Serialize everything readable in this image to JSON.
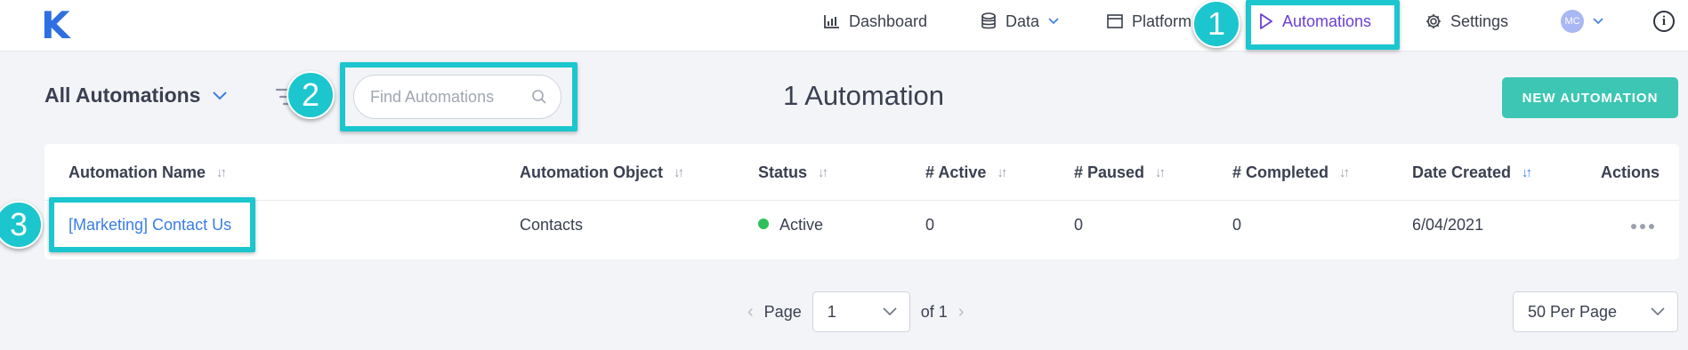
{
  "app": {
    "logo": "K"
  },
  "nav": {
    "items": [
      {
        "label": "Dashboard",
        "icon": "bar-chart-icon"
      },
      {
        "label": "Data",
        "icon": "database-icon"
      },
      {
        "label": "Platform",
        "icon": "window-icon"
      },
      {
        "label": "Automations",
        "icon": "play-icon",
        "active": true
      },
      {
        "label": "Settings",
        "icon": "gear-icon"
      }
    ],
    "avatar_initials": "MC",
    "info_glyph": "i"
  },
  "toolbar": {
    "view_label": "All Automations",
    "search_placeholder": "Find Automations",
    "count_title": "1 Automation",
    "new_button": "NEW AUTOMATION"
  },
  "table": {
    "columns": [
      "Automation Name",
      "Automation Object",
      "Status",
      "# Active",
      "# Paused",
      "# Completed",
      "Date Created",
      "Actions"
    ],
    "rows": [
      {
        "name": "[Marketing] Contact Us",
        "object": "Contacts",
        "status": "Active",
        "active": "0",
        "paused": "0",
        "completed": "0",
        "date_created": "6/04/2021"
      }
    ]
  },
  "pagination": {
    "page_label": "Page",
    "page_value": "1",
    "of_label": "of 1",
    "per_page": "50 Per Page"
  },
  "annotations": {
    "badge_1": "1",
    "badge_2": "2",
    "badge_3": "3"
  },
  "colors": {
    "accent_teal": "#1bc6cf",
    "brand_blue": "#2f6fe3",
    "active_nav": "#6a3fd8",
    "button_green": "#3cc6b3",
    "status_active": "#2ec05a",
    "link_blue": "#3b7de8"
  }
}
